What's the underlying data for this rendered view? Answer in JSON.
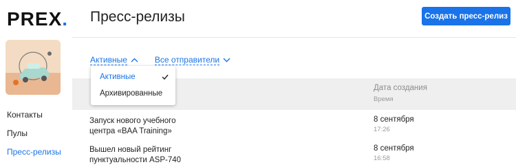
{
  "brand": {
    "logo_text": "PREX",
    "logo_dot": ".",
    "accent": "#1a73e8"
  },
  "header": {
    "title": "Пресс-релизы",
    "create_button": "Создать пресс-релиз"
  },
  "sidebar": {
    "items": [
      {
        "label": "Контакты",
        "active": false
      },
      {
        "label": "Пулы",
        "active": false
      },
      {
        "label": "Пресс-релизы",
        "active": true
      }
    ]
  },
  "filters": {
    "status": {
      "label": "Активные",
      "icon": "chevron-up-icon"
    },
    "senders": {
      "label": "Все отправители",
      "icon": "chevron-down-icon"
    }
  },
  "dropdown": {
    "options": [
      {
        "label": "Активные",
        "selected": true
      },
      {
        "label": "Архивированные",
        "selected": false
      }
    ]
  },
  "table": {
    "columns": {
      "date": "Дата создания",
      "time": "Время"
    },
    "rows": [
      {
        "title": "Запуск нового учебного центра «BAA Training»",
        "date": "8 сентября",
        "time": "17:26"
      },
      {
        "title": "Вышел новый рейтинг пунктуальности ASP-740",
        "date": "8 сентября",
        "time": "16:58"
      }
    ]
  }
}
